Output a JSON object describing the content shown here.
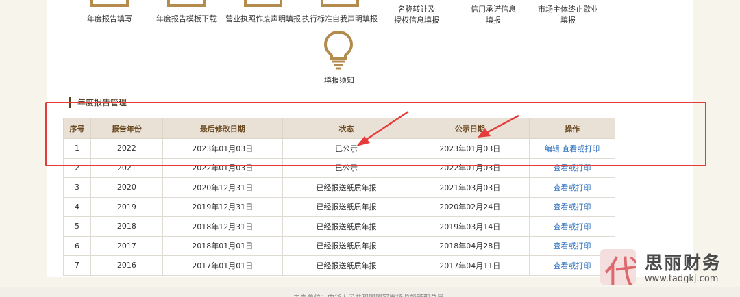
{
  "top_tiles": [
    {
      "label": "年度报告填写"
    },
    {
      "label": "年度报告模板下载"
    },
    {
      "label": "营业执照作废声明填报"
    },
    {
      "label": "执行标准自我声明填报"
    },
    {
      "label": "名称转让及\n授权信息填报"
    },
    {
      "label": "信用承诺信息\n填报"
    },
    {
      "label": "市场主体终止歇业\n填报"
    }
  ],
  "notice": {
    "label": "填报须知",
    "icon": "lightbulb-icon"
  },
  "section": {
    "title": "年度报告管理"
  },
  "table": {
    "headers": [
      "序号",
      "报告年份",
      "最后修改日期",
      "状态",
      "公示日期",
      "操作"
    ],
    "rows": [
      {
        "no": "1",
        "year": "2022",
        "modified": "2023年01月03日",
        "status": "已公示",
        "pub_date": "2023年01月03日",
        "ops": [
          "编辑",
          "查看或打印"
        ]
      },
      {
        "no": "2",
        "year": "2021",
        "modified": "2022年01月03日",
        "status": "已公示",
        "pub_date": "2022年01月03日",
        "ops": [
          "查看或打印"
        ]
      },
      {
        "no": "3",
        "year": "2020",
        "modified": "2020年12月31日",
        "status": "已经报送纸质年报",
        "pub_date": "2021年03月03日",
        "ops": [
          "查看或打印"
        ]
      },
      {
        "no": "4",
        "year": "2019",
        "modified": "2019年12月31日",
        "status": "已经报送纸质年报",
        "pub_date": "2020年02月24日",
        "ops": [
          "查看或打印"
        ]
      },
      {
        "no": "5",
        "year": "2018",
        "modified": "2018年12月31日",
        "status": "已经报送纸质年报",
        "pub_date": "2019年03月14日",
        "ops": [
          "查看或打印"
        ]
      },
      {
        "no": "6",
        "year": "2017",
        "modified": "2018年01月01日",
        "status": "已经报送纸质年报",
        "pub_date": "2018年04月28日",
        "ops": [
          "查看或打印"
        ]
      },
      {
        "no": "7",
        "year": "2016",
        "modified": "2017年01月01日",
        "status": "已经报送纸质年报",
        "pub_date": "2017年04月11日",
        "ops": [
          "查看或打印"
        ]
      }
    ]
  },
  "footer": {
    "text": "主办单位：中华人民共和国国家市场监督管理总局"
  },
  "watermark": {
    "char": "代",
    "name": "思丽财务",
    "url": "www.tadgkj.com"
  },
  "colors": {
    "accent": "#b38b4d",
    "header_bg": "#e9e1d6",
    "link": "#2b6fbf",
    "annotation": "#e53b3b"
  }
}
